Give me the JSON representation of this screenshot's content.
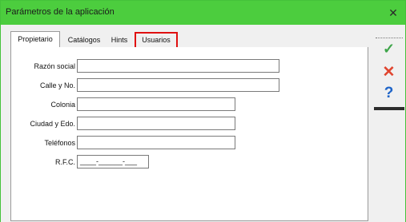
{
  "window": {
    "title": "Parámetros de la aplicación",
    "close_glyph": "✕"
  },
  "tabs": [
    {
      "label": "Propietario",
      "active": true
    },
    {
      "label": "Catálogos",
      "active": false
    },
    {
      "label": "Hints",
      "active": false
    },
    {
      "label": "Usuarios",
      "active": false,
      "highlighted": true
    }
  ],
  "form": {
    "fields": [
      {
        "label": "Razón social",
        "value": ""
      },
      {
        "label": "Calle y No.",
        "value": ""
      },
      {
        "label": "Colonia",
        "value": ""
      },
      {
        "label": "Ciudad y Edo.",
        "value": ""
      },
      {
        "label": "Teléfonos",
        "value": ""
      },
      {
        "label": "R.F.C.",
        "value": "____-______-___"
      }
    ]
  },
  "sidebar": {
    "accept_icon": "check-icon",
    "cancel_icon": "cross-icon",
    "help_icon": "help-icon",
    "glyphs": {
      "accept": "✓",
      "cancel": "✕",
      "help": "?"
    }
  },
  "colors": {
    "titlebar": "#4ccd3e",
    "highlight": "#e01010",
    "accept": "#3fa54a",
    "cancel": "#e0452f",
    "help": "#1e64c8"
  }
}
